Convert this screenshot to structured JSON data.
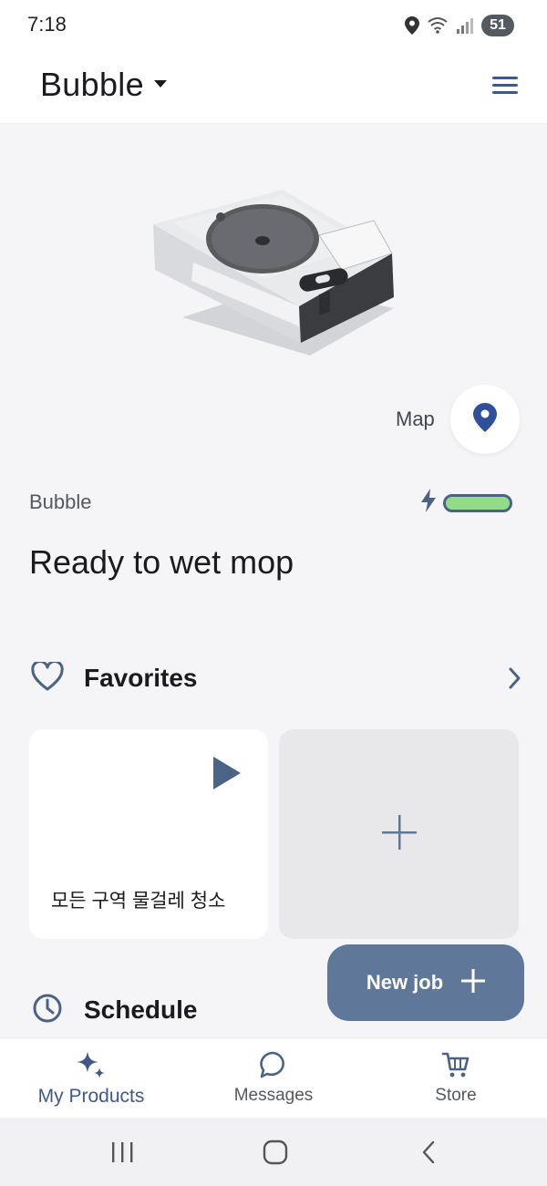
{
  "status_bar": {
    "time": "7:18",
    "battery_level": "51",
    "icons": [
      "location-icon",
      "wifi-icon",
      "signal-icon",
      "battery-icon"
    ]
  },
  "header": {
    "device_name": "Bubble",
    "icons": [
      "caret-down-icon",
      "hamburger-menu-icon"
    ]
  },
  "map": {
    "label": "Map",
    "icon": "map-pin-icon"
  },
  "robot_status": {
    "name": "Bubble",
    "state": "Ready to wet mop",
    "battery_charge_fraction": 1.0,
    "charging": true
  },
  "favorites": {
    "title": "Favorites",
    "items": [
      {
        "label": "모든 구역 물걸레 청소"
      }
    ]
  },
  "schedule": {
    "title": "Schedule"
  },
  "fab": {
    "label": "New job"
  },
  "bottom_nav": {
    "items": [
      {
        "label": "My Products",
        "icon": "sparkle-icon",
        "active": true
      },
      {
        "label": "Messages",
        "icon": "chat-bubble-icon",
        "active": false
      },
      {
        "label": "Store",
        "icon": "cart-icon",
        "active": false
      }
    ]
  },
  "colors": {
    "accent": "#3f5a86",
    "fab": "#5f7899",
    "battery_fill": "#93dd8a",
    "pin": "#2f4f9a"
  }
}
